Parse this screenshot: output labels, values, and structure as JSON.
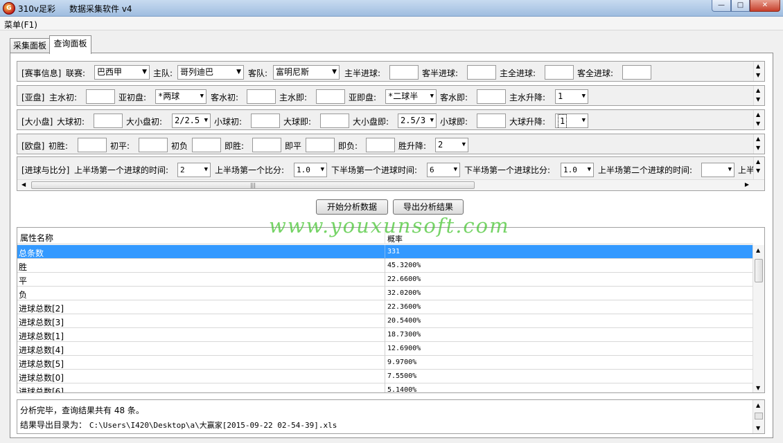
{
  "window": {
    "app_name": "310v足彩",
    "subtitle": "数据采集软件 v4",
    "icon_name": "app-logo-icon",
    "controls": {
      "minimize": "—",
      "maximize": "□",
      "close": "✕"
    }
  },
  "menu": {
    "label": "菜单(F1)"
  },
  "tabs": [
    {
      "label": "采集面板"
    },
    {
      "label": "查询面板"
    }
  ],
  "filters": {
    "match": {
      "section": "[赛事信息]",
      "league_label": "联赛:",
      "league_value": "巴西甲",
      "home_label": "主队:",
      "home_value": "哥列迪巴",
      "away_label": "客队:",
      "away_value": "富明尼斯",
      "home_half_label": "主半进球:",
      "away_half_label": "客半进球:",
      "home_full_label": "主全进球:",
      "away_full_label": "客全进球:"
    },
    "asian": {
      "section": "[亚盘]",
      "home_init_label": "主水初:",
      "asia_init_label": "亚初盘:",
      "asia_init_value": "*两球",
      "away_init_label": "客水初:",
      "home_now_label": "主水即:",
      "asia_now_label": "亚即盘:",
      "asia_now_value": "*二球半",
      "away_now_label": "客水即:",
      "home_change_label": "主水升降:",
      "home_change_value": "1"
    },
    "ou": {
      "section": "[大小盘]",
      "over_init_label": "大球初:",
      "line_init_label": "大小盘初:",
      "line_init_value": "2/2.5",
      "under_init_label": "小球初:",
      "over_now_label": "大球即:",
      "line_now_label": "大小盘即:",
      "line_now_value": "2.5/3",
      "under_now_label": "小球即:",
      "over_change_label": "大球升降:",
      "over_change_value": "1"
    },
    "euro": {
      "section": "[欧盘]",
      "win_init_label": "初胜:",
      "draw_init_label": "初平:",
      "lose_init_label": "初负",
      "win_now_label": "即胜:",
      "draw_now_label": "即平",
      "lose_now_label": "即负:",
      "win_change_label": "胜升降:",
      "win_change_value": "2"
    },
    "goals": {
      "section": "[进球与比分]",
      "h1_first_time_label": "上半场第一个进球的时间:",
      "h1_first_time_value": "2",
      "h1_first_score_label": "上半场第一个比分:",
      "h1_first_score_value": "1.0",
      "h2_first_time_label": "下半场第一个进球时间:",
      "h2_first_time_value": "6",
      "h2_first_score_label": "下半场第一个进球比分:",
      "h2_first_score_value": "1.0",
      "h1_second_time_label": "上半场第二个进球的时间:",
      "h1_second_time_value": "",
      "more_label": "上半"
    }
  },
  "actions": {
    "analyze": "开始分析数据",
    "export": "导出分析结果"
  },
  "watermark": "www.youxunsoft.com",
  "results": {
    "headers": [
      "属性名称",
      "概率"
    ],
    "rows": [
      {
        "name": "总条数",
        "value": "331"
      },
      {
        "name": "胜",
        "value": "45.3200%"
      },
      {
        "name": "平",
        "value": "22.6600%"
      },
      {
        "name": "负",
        "value": "32.0200%"
      },
      {
        "name": "进球总数[2]",
        "value": "22.3600%"
      },
      {
        "name": "进球总数[3]",
        "value": "20.5400%"
      },
      {
        "name": "进球总数[1]",
        "value": "18.7300%"
      },
      {
        "name": "进球总数[4]",
        "value": "12.6900%"
      },
      {
        "name": "进球总数[5]",
        "value": "9.9700%"
      },
      {
        "name": "进球总数[0]",
        "value": "7.5500%"
      },
      {
        "name": "进球总数[6]",
        "value": "5.1400%"
      }
    ]
  },
  "log": {
    "line1": "分析完毕，查询结果共有 48 条。",
    "line2_prefix": "结果导出目录为：",
    "line2_path": "C:\\Users\\I420\\Desktop\\a\\大赢家[2015-09-22 02-54-39].xls"
  },
  "colors": {
    "selection": "#3399ff",
    "watermark": "#50c83c",
    "titlebar": "#9fbde0"
  }
}
